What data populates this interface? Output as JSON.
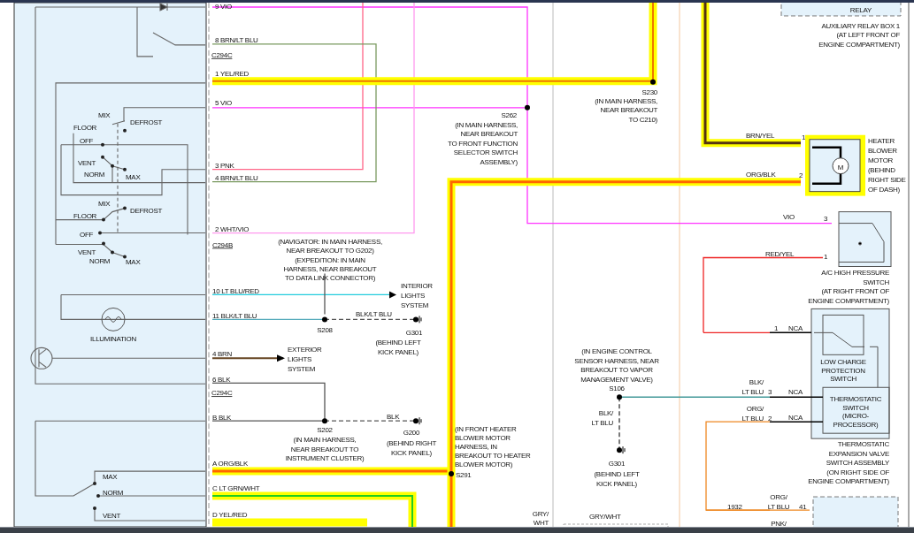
{
  "diagram": {
    "labels": [
      {
        "kind": "wire",
        "lines": [
          "9 VIO"
        ]
      },
      {
        "kind": "wire",
        "lines": [
          "8 BRN/LT BLU"
        ]
      },
      {
        "kind": "connector",
        "lines": [
          "C294C"
        ]
      },
      {
        "kind": "wire",
        "lines": [
          "1 YEL/RED"
        ]
      },
      {
        "kind": "wire",
        "lines": [
          "5 VIO"
        ]
      },
      {
        "kind": "wire",
        "lines": [
          "3 PNK"
        ]
      },
      {
        "kind": "wire",
        "lines": [
          "4 BRN/LT BLU"
        ]
      },
      {
        "kind": "wire",
        "lines": [
          "2 WHT/VIO"
        ]
      },
      {
        "kind": "connector",
        "lines": [
          "C294B"
        ]
      },
      {
        "kind": "position",
        "lines": [
          "MIX"
        ]
      },
      {
        "kind": "position",
        "lines": [
          "DEFROST"
        ]
      },
      {
        "kind": "position",
        "lines": [
          "FLOOR"
        ]
      },
      {
        "kind": "position",
        "lines": [
          "OFF"
        ]
      },
      {
        "kind": "position",
        "lines": [
          "VENT"
        ]
      },
      {
        "kind": "position",
        "lines": [
          "NORM"
        ]
      },
      {
        "kind": "position",
        "lines": [
          "MAX"
        ]
      },
      {
        "kind": "position",
        "lines": [
          "MIX"
        ]
      },
      {
        "kind": "position",
        "lines": [
          "DEFROST"
        ]
      },
      {
        "kind": "position",
        "lines": [
          "FLOOR"
        ]
      },
      {
        "kind": "position",
        "lines": [
          "OFF"
        ]
      },
      {
        "kind": "position",
        "lines": [
          "VENT"
        ]
      },
      {
        "kind": "position",
        "lines": [
          "NORM"
        ]
      },
      {
        "kind": "position",
        "lines": [
          "MAX"
        ]
      },
      {
        "kind": "component",
        "lines": [
          "ILLUMINATION"
        ]
      },
      {
        "kind": "wire",
        "lines": [
          "10 LT BLU/RED"
        ]
      },
      {
        "kind": "wire",
        "lines": [
          "11 BLK/LT BLU"
        ]
      },
      {
        "kind": "wire",
        "lines": [
          "4 BRN"
        ]
      },
      {
        "kind": "wire",
        "lines": [
          "6 BLK"
        ]
      },
      {
        "kind": "connector",
        "lines": [
          "C294C"
        ]
      },
      {
        "kind": "wire",
        "lines": [
          "B  BLK"
        ]
      },
      {
        "kind": "wire",
        "lines": [
          "A  ORG/BLK"
        ]
      },
      {
        "kind": "wire",
        "lines": [
          "C  LT GRN/WHT"
        ]
      },
      {
        "kind": "wire",
        "lines": [
          "D  YEL/RED"
        ]
      },
      {
        "kind": "position",
        "lines": [
          "MAX"
        ]
      },
      {
        "kind": "position",
        "lines": [
          "NORM"
        ]
      },
      {
        "kind": "position",
        "lines": [
          "VENT"
        ]
      },
      {
        "kind": "note",
        "lines": [
          "(NAVIGATOR: IN MAIN HARNESS,",
          "NEAR BREAKOUT TO G202)",
          "(EXPEDITION: IN MAIN",
          "HARNESS, NEAR BREAKOUT",
          "TO DATA LINK CONNECTOR)"
        ]
      },
      {
        "kind": "component",
        "lines": [
          "INTERIOR",
          "LIGHTS",
          "SYSTEM"
        ]
      },
      {
        "kind": "wire",
        "lines": [
          "BLK/LT BLU"
        ]
      },
      {
        "kind": "splice",
        "lines": [
          "S208"
        ]
      },
      {
        "kind": "splice",
        "lines": [
          "G301"
        ]
      },
      {
        "kind": "note",
        "lines": [
          "(BEHIND LEFT",
          "KICK PANEL)"
        ]
      },
      {
        "kind": "component",
        "lines": [
          "EXTERIOR",
          "LIGHTS",
          "SYSTEM"
        ]
      },
      {
        "kind": "wire",
        "lines": [
          "BLK"
        ]
      },
      {
        "kind": "splice",
        "lines": [
          "S202"
        ]
      },
      {
        "kind": "note",
        "lines": [
          "(IN MAIN HARNESS,",
          "NEAR BREAKOUT TO",
          "INSTRUMENT CLUSTER)"
        ]
      },
      {
        "kind": "splice",
        "lines": [
          "G200"
        ]
      },
      {
        "kind": "note",
        "lines": [
          "(BEHIND RIGHT",
          "KICK PANEL)"
        ]
      },
      {
        "kind": "splice",
        "lines": [
          "S262"
        ]
      },
      {
        "kind": "note",
        "lines": [
          "(IN MAIN HARNESS,",
          "NEAR BREAKOUT",
          "TO FRONT FUNCTION",
          "SELECTOR SWITCH",
          "ASSEMBLY)"
        ]
      },
      {
        "kind": "splice",
        "lines": [
          "S230"
        ]
      },
      {
        "kind": "note",
        "lines": [
          "(IN MAIN HARNESS,",
          "NEAR BREAKOUT",
          "TO C210)"
        ]
      },
      {
        "kind": "component",
        "lines": [
          "RELAY"
        ]
      },
      {
        "kind": "component",
        "lines": [
          "AUXILIARY RELAY BOX 1",
          "(AT LEFT FRONT OF",
          "ENGINE COMPARTMENT)"
        ]
      },
      {
        "kind": "wire",
        "lines": [
          "BRN/YEL"
        ]
      },
      {
        "kind": "pin",
        "lines": [
          "1"
        ]
      },
      {
        "kind": "wire",
        "lines": [
          "ORG/BLK"
        ]
      },
      {
        "kind": "pin",
        "lines": [
          "2"
        ]
      },
      {
        "kind": "component",
        "lines": [
          "HEATER",
          "BLOWER",
          "MOTOR",
          "(BEHIND",
          "RIGHT SIDE",
          "OF DASH)"
        ]
      },
      {
        "kind": "wire",
        "lines": [
          "VIO"
        ]
      },
      {
        "kind": "pin",
        "lines": [
          "3"
        ]
      },
      {
        "kind": "wire",
        "lines": [
          "RED/YEL"
        ]
      },
      {
        "kind": "pin",
        "lines": [
          "1"
        ]
      },
      {
        "kind": "component",
        "lines": [
          "A/C HIGH PRESSURE",
          "SWITCH",
          "(AT RIGHT FRONT OF",
          "ENGINE COMPARTMENT)"
        ]
      },
      {
        "kind": "pin",
        "lines": [
          "1"
        ]
      },
      {
        "kind": "wire",
        "lines": [
          "NCA"
        ]
      },
      {
        "kind": "component",
        "lines": [
          "LOW CHARGE",
          "PROTECTION",
          "SWITCH"
        ]
      },
      {
        "kind": "wire",
        "lines": [
          "BLK/",
          "LT BLU"
        ]
      },
      {
        "kind": "pin",
        "lines": [
          "3"
        ]
      },
      {
        "kind": "wire",
        "lines": [
          "NCA"
        ]
      },
      {
        "kind": "wire",
        "lines": [
          "ORG/",
          "LT BLU"
        ]
      },
      {
        "kind": "pin",
        "lines": [
          "2"
        ]
      },
      {
        "kind": "wire",
        "lines": [
          "NCA"
        ]
      },
      {
        "kind": "component",
        "lines": [
          "THERMOSTATIC",
          "SWITCH",
          "(MICRO-",
          "PROCESSOR)"
        ]
      },
      {
        "kind": "component",
        "lines": [
          "THERMOSTATIC",
          "EXPANSION VALVE",
          "SWITCH ASSEMBLY",
          "(ON RIGHT SIDE OF",
          "ENGINE COMPARTMENT)"
        ]
      },
      {
        "kind": "note",
        "lines": [
          "(IN ENGINE CONTROL",
          "SENSOR HARNESS, NEAR",
          "BREAKOUT TO VAPOR",
          "MANAGEMENT VALVE)"
        ]
      },
      {
        "kind": "splice",
        "lines": [
          "S106"
        ]
      },
      {
        "kind": "wire",
        "lines": [
          "BLK/",
          "LT BLU"
        ]
      },
      {
        "kind": "splice",
        "lines": [
          "G301"
        ]
      },
      {
        "kind": "note",
        "lines": [
          "(BEHIND LEFT",
          "KICK PANEL)"
        ]
      },
      {
        "kind": "note",
        "lines": [
          "(IN FRONT HEATER",
          "BLOWER MOTOR",
          "HARNESS, IN",
          "BREAKOUT TO HEATER",
          "BLOWER MOTOR)"
        ]
      },
      {
        "kind": "splice",
        "lines": [
          "S291"
        ]
      },
      {
        "kind": "wire",
        "lines": [
          "GRY/",
          "WHT"
        ]
      },
      {
        "kind": "wire",
        "lines": [
          "GRY/WHT"
        ]
      },
      {
        "kind": "pin",
        "lines": [
          "1932"
        ]
      },
      {
        "kind": "wire",
        "lines": [
          "ORG/",
          "LT BLU"
        ]
      },
      {
        "kind": "pin",
        "lines": [
          "41"
        ]
      },
      {
        "kind": "wire",
        "lines": [
          "PNK/"
        ]
      },
      {
        "kind": "symbol",
        "lines": [
          "M"
        ]
      }
    ]
  }
}
